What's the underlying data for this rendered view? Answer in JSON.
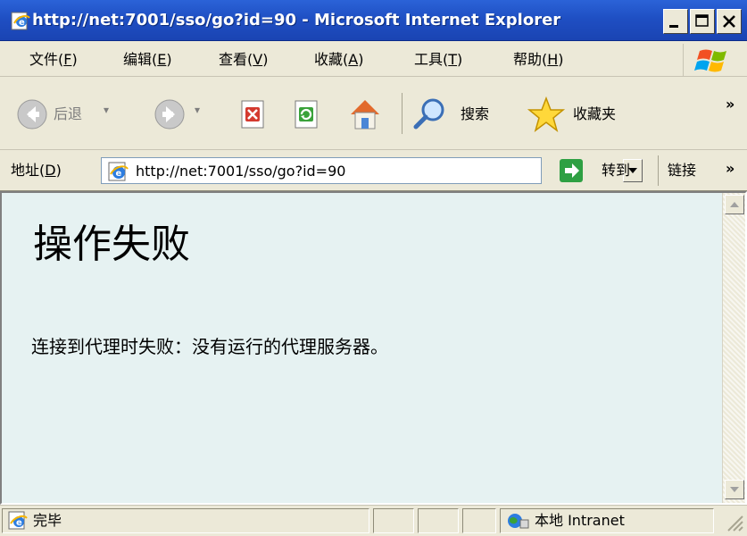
{
  "window": {
    "title": "http://net:7001/sso/go?id=90 - Microsoft Internet Explorer"
  },
  "menu": [
    {
      "label": "文件(F)",
      "text": "文件(",
      "mn": "F",
      "close": ")"
    },
    {
      "label": "编辑(E)",
      "text": "编辑(",
      "mn": "E",
      "close": ")"
    },
    {
      "label": "查看(V)",
      "text": "查看(",
      "mn": "V",
      "close": ")"
    },
    {
      "label": "收藏(A)",
      "text": "收藏(",
      "mn": "A",
      "close": ")"
    },
    {
      "label": "工具(T)",
      "text": "工具(",
      "mn": "T",
      "close": ")"
    },
    {
      "label": "帮助(H)",
      "text": "帮助(",
      "mn": "H",
      "close": ")"
    }
  ],
  "toolbar": {
    "back_label": "后退",
    "search_label": "搜索",
    "favorites_label": "收藏夹",
    "chevron": "»"
  },
  "address": {
    "label_text": "地址(",
    "label_mn": "D",
    "label_close": ")",
    "url": "http://net:7001/sso/go?id=90",
    "go_label": "转到",
    "links_label": "链接",
    "chevron": "»"
  },
  "page": {
    "heading": "操作失败",
    "message": "连接到代理时失败：没有运行的代理服务器。"
  },
  "status": {
    "text": "完毕",
    "zone": "本地 Intranet"
  }
}
